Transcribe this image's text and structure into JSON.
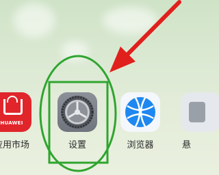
{
  "apps": [
    {
      "name": "应用市场",
      "icon": "huawei-appgallery-icon",
      "icon_text": "HUAWEI",
      "color": "#e0262b"
    },
    {
      "name": "设置",
      "icon": "gear-icon",
      "color": "#7c818a"
    },
    {
      "name": "浏览器",
      "icon": "globe-icon",
      "color": "#1e88f0"
    },
    {
      "name": "悬",
      "icon": "partial-app-icon",
      "color": "#9aa0a7"
    }
  ],
  "annotation": {
    "ellipse_color": "#2fa52f",
    "rect_color": "#2fa52f",
    "arrow_color": "#e0201c"
  }
}
